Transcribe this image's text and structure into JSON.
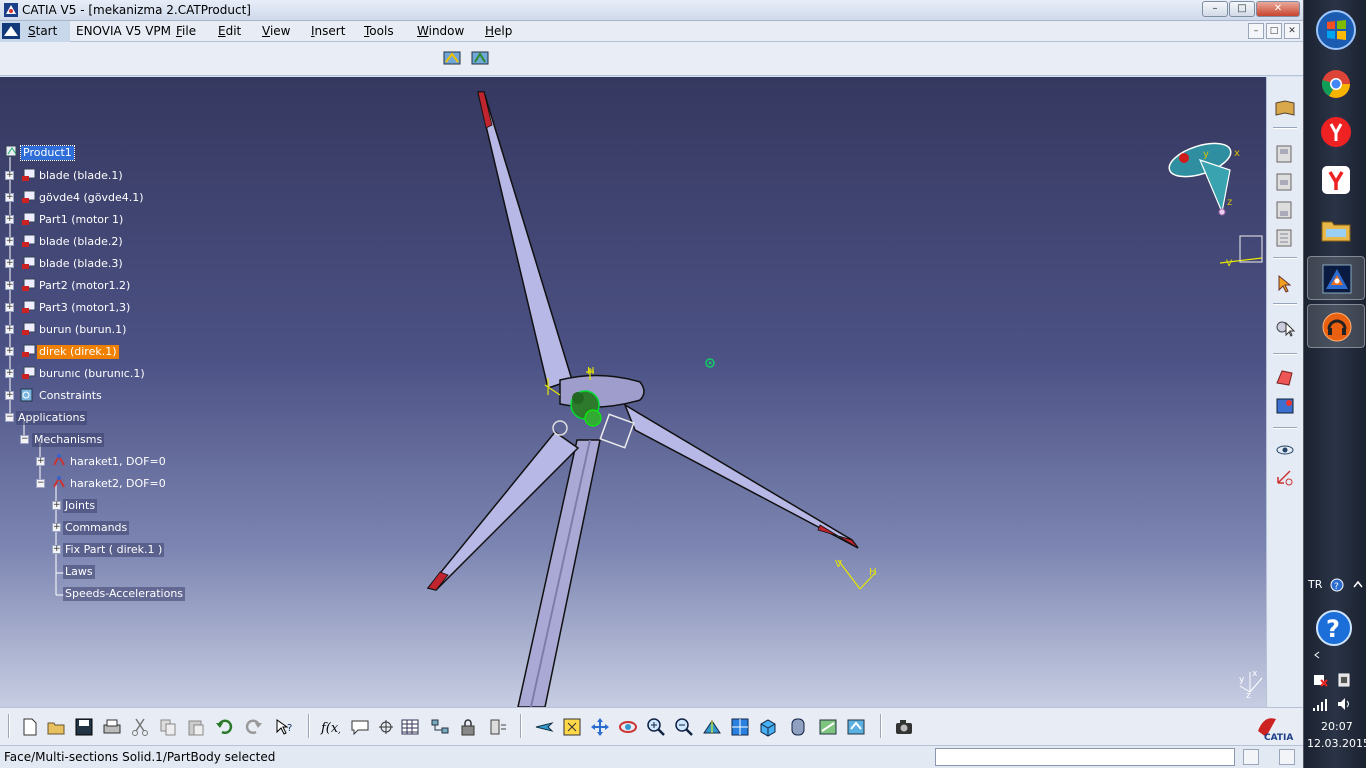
{
  "window": {
    "title": "CATIA V5 - [mekanizma 2.CATProduct]",
    "min": "–",
    "max": "□",
    "close": "✕"
  },
  "menu": {
    "start": "Start",
    "enovia": "ENOVIA V5 VPM",
    "file": "File",
    "edit": "Edit",
    "view": "View",
    "insert": "Insert",
    "tools": "Tools",
    "window": "Window",
    "help": "Help"
  },
  "tree": {
    "root": "Product1",
    "parts": [
      "blade (blade.1)",
      "gövde4 (gövde4.1)",
      "Part1 (motor 1)",
      "blade (blade.2)",
      "blade (blade.3)",
      "Part2 (motor1.2)",
      "Part3 (motor1,3)",
      "burun (burun.1)",
      "direk (direk.1)",
      "burunıc (burunıc.1)"
    ],
    "constraints": "Constraints",
    "applications": "Applications",
    "mechanisms": "Mechanisms",
    "mech1": "haraket1, DOF=0",
    "mech2": "haraket2, DOF=0",
    "joints": "Joints",
    "commands": "Commands",
    "fixpart": "Fix Part ( direk.1 )",
    "laws": "Laws",
    "speeds": "Speeds-Accelerations"
  },
  "viewport": {
    "compass": {
      "x": "x",
      "y": "y",
      "z": "z"
    },
    "axis_labels": {
      "v": "V",
      "h": "H"
    }
  },
  "status": {
    "message": "Face/Multi-sections Solid.1/PartBody selected"
  },
  "taskbar": {
    "language": "TR",
    "time": "20:07",
    "date": "12.03.2015",
    "apps": [
      "windows-start",
      "chrome",
      "yandex",
      "yandex-browser",
      "file-explorer",
      "catia",
      "media-player"
    ]
  },
  "colors": {
    "viewport_top": "#35385f",
    "viewport_bottom": "#c7cde2",
    "tree_selected": "#2f6ed8",
    "tree_highlight": "#f08000",
    "blade_fill": "#b8b8e6",
    "blade_tip": "#c0242e"
  }
}
